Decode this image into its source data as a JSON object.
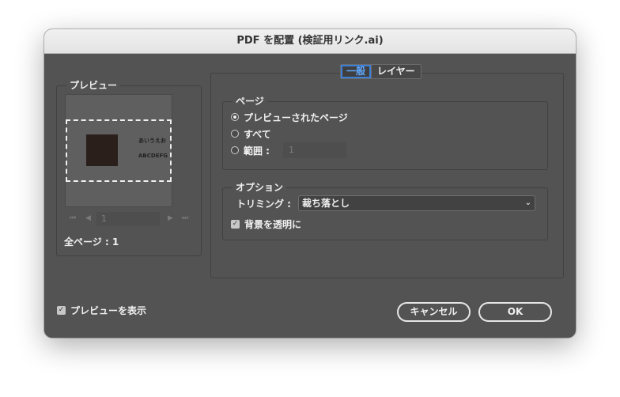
{
  "window": {
    "title": "PDF を配置 (検証用リンク.ai)"
  },
  "preview_panel": {
    "legend": "プレビュー",
    "art_text_line1": "あいうえお",
    "art_text_line2": "ABCDEFG",
    "page_field_value": "1",
    "total_pages": "全ページ : 1"
  },
  "tabs": [
    {
      "label": "一般",
      "active": true
    },
    {
      "label": "レイヤー",
      "active": false
    }
  ],
  "page_group": {
    "legend": "ページ",
    "options": [
      {
        "label": "プレビューされたページ",
        "selected": true
      },
      {
        "label": "すべて",
        "selected": false
      },
      {
        "label": "範囲 :",
        "selected": false
      }
    ],
    "range_value": "1"
  },
  "option_group": {
    "legend": "オプション",
    "trimming_label": "トリミング :",
    "trimming_value": "裁ち落とし",
    "transparent_bg_label": "背景を透明に",
    "transparent_bg_checked": true
  },
  "footer": {
    "show_preview_label": "プレビューを表示",
    "show_preview_checked": true,
    "cancel_label": "キャンセル",
    "ok_label": "OK"
  },
  "colors": {
    "dialog_bg": "#535353",
    "accent_tab": "#60a8ff"
  }
}
